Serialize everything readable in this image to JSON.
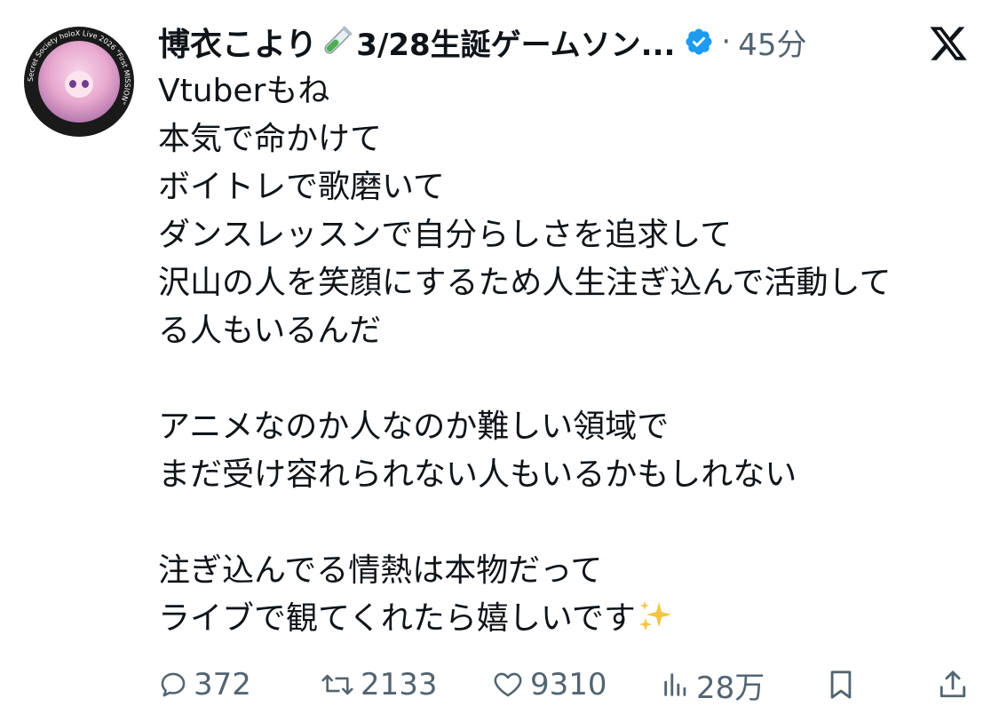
{
  "post": {
    "author": {
      "display_name": "博衣こより",
      "name_suffix": "3/28生誕ゲームソン...",
      "avatar_ring_text": "Secret Society holoX Live 2026 \"First MISSION\"",
      "verified": true,
      "verified_color": "#1d9bf0"
    },
    "timestamp_separator": "·",
    "timestamp": "45分",
    "brand_icon": "x-logo-icon",
    "lines": [
      "Vtuberもね",
      "本気で命かけて",
      "ボイトレで歌磨いて",
      "ダンスレッスンで自分らしさを追求して",
      "沢山の人を笑顔にするため人生注ぎ込んで活動して",
      "る人もいるんだ",
      "",
      "アニメなのか人なのか難しい領域で",
      "まだ受け容れられない人もいるかもしれない",
      "",
      "注ぎ込んでる情熱は本物だって",
      "ライブで観てくれたら嬉しいです"
    ],
    "trailing_emoji": "sparkles-icon"
  },
  "actions": {
    "replies": "372",
    "reposts": "2133",
    "likes": "9310",
    "views": "28万"
  },
  "colors": {
    "text": "#0f1419",
    "muted": "#536471",
    "verified": "#1d9bf0",
    "sparkle": "#f5c542"
  }
}
